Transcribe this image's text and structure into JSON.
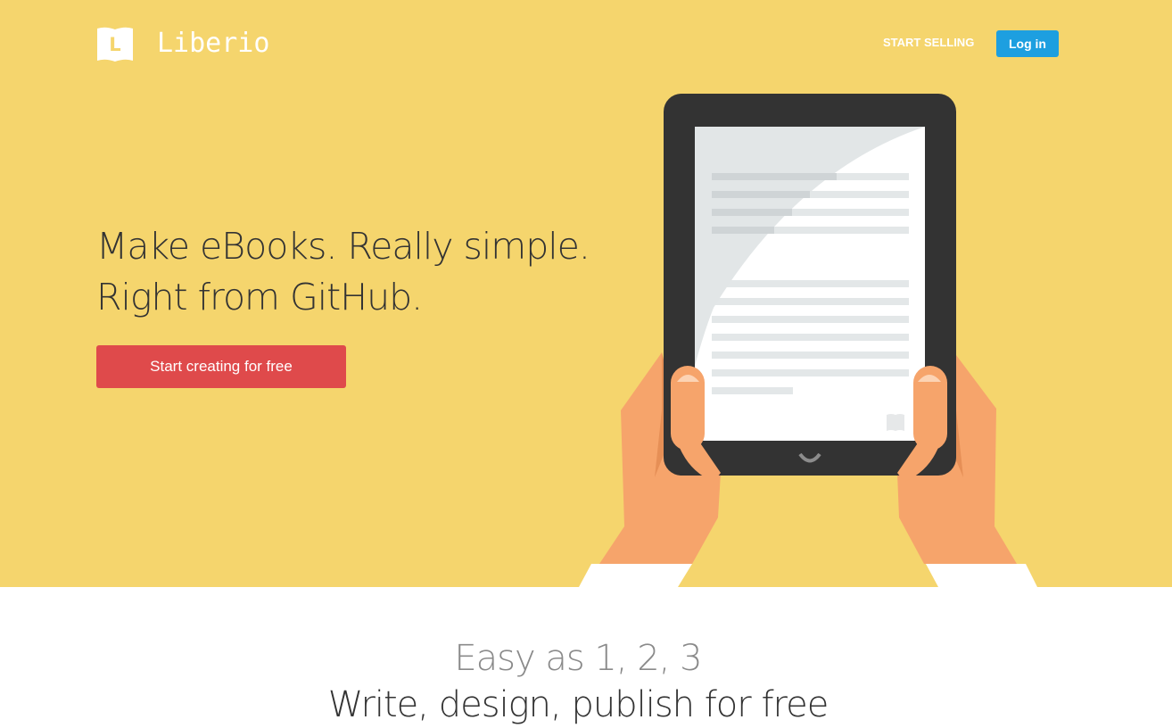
{
  "header": {
    "logo_text": "Liberio",
    "logo_letter": "L",
    "nav_start_selling": "START SELLING",
    "nav_login": "Log in"
  },
  "hero": {
    "headline_line1": "Make eBooks. Really simple.",
    "headline_line2": "Right from GitHub.",
    "cta_label": "Start creating for free"
  },
  "features": {
    "title": "Easy as 1, 2, 3",
    "subtitle": "Write, design, publish for free"
  },
  "icons": {
    "logo": "book-logo-icon",
    "illustration": "hands-holding-tablet-illustration"
  },
  "colors": {
    "hero_bg": "#f5d56d",
    "login_blue": "#1d9fe0",
    "cta_red": "#df4a4b",
    "tablet_frame": "#333333",
    "skin": "#f6a46b"
  }
}
